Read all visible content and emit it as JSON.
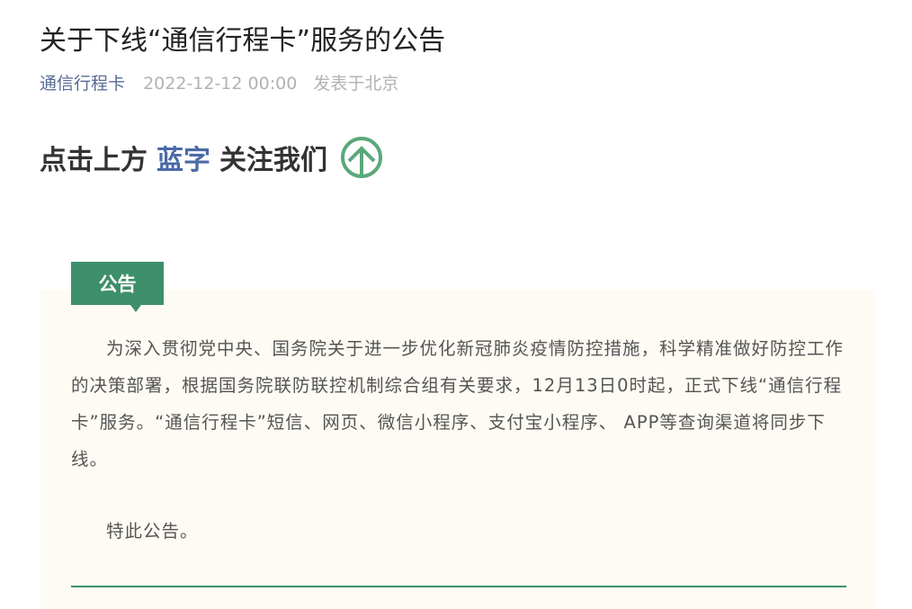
{
  "article": {
    "title": "关于下线“通信行程卡”服务的公告",
    "account_name": "通信行程卡",
    "publish_time": "2022-12-12 00:00",
    "location": "发表于北京"
  },
  "follow_banner": {
    "prefix": "点击上方",
    "highlight": "蓝字",
    "suffix": "关注我们",
    "icon": "up-arrow-circle-icon"
  },
  "notice": {
    "tag_label": "公告",
    "paragraph": "为深入贯彻党中央、国务院关于进一步优化新冠肺炎疫情防控措施，科学精准做好防控工作的决策部署，根据国务院联防联控机制综合组有关要求，12月13日0时起，正式下线“通信行程卡”服务。“通信行程卡”短信、网页、微信小程序、支付宝小程序、 APP等查询渠道将同步下线。",
    "closing": "特此公告。"
  },
  "colors": {
    "accent_green": "#3d8f6b",
    "link_blue": "#576b95",
    "highlight_blue": "#4b6aa6",
    "box_background": "#fdfbf3"
  }
}
